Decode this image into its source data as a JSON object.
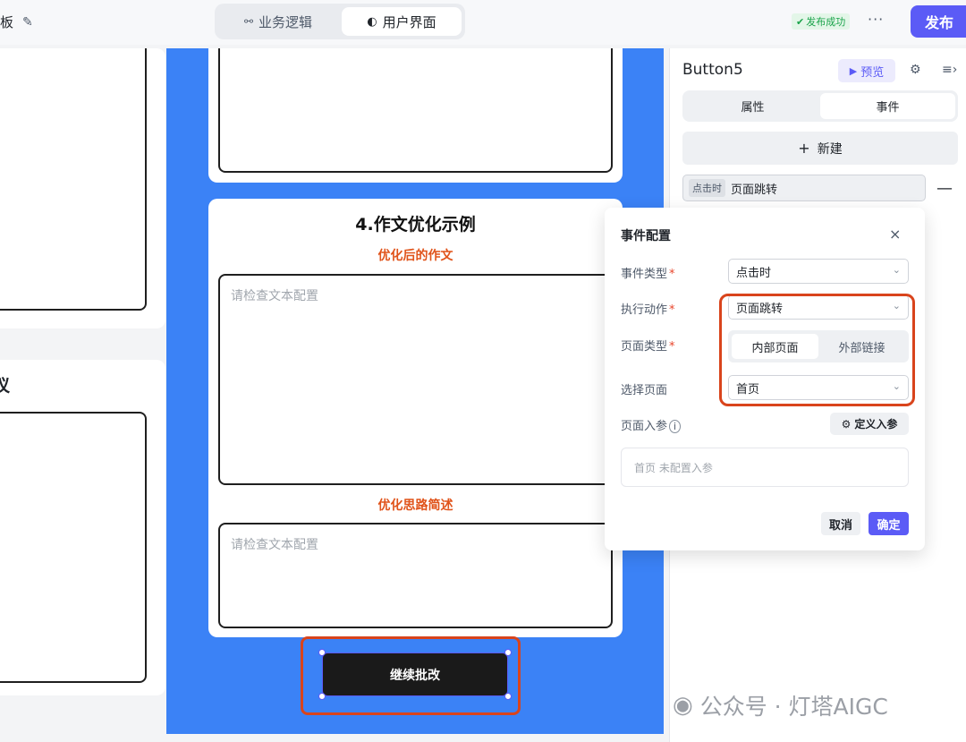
{
  "topbar": {
    "left_text": "板",
    "tabs": [
      {
        "icon": "flow-icon",
        "label": "业务逻辑"
      },
      {
        "icon": "palette-icon",
        "label": "用户界面"
      }
    ],
    "status_badge": "发布成功",
    "more": "···",
    "publish_label": "发布"
  },
  "canvas": {
    "left_fragment": "议",
    "card4": {
      "title": "4.作文优化示例",
      "subtitle_1": "优化后的作文",
      "placeholder_1": "请检查文本配置",
      "subtitle_2": "优化思路简述",
      "placeholder_2": "请检查文本配置"
    },
    "main_button_label": "继续批改"
  },
  "panel": {
    "title": "Button5",
    "preview_label": "预览",
    "tabs": [
      "属性",
      "事件"
    ],
    "active_tab": "事件",
    "new_label": "新建",
    "event_row": {
      "tag": "点击时",
      "label": "页面跳转"
    },
    "remove_icon": "—"
  },
  "popover": {
    "title": "事件配置",
    "close": "×",
    "event_type_label": "事件类型",
    "event_type_value": "点击时",
    "action_label": "执行动作",
    "action_value": "页面跳转",
    "page_type_label": "页面类型",
    "page_type_options": [
      "内部页面",
      "外部链接"
    ],
    "page_type_selected": "内部页面",
    "select_page_label": "选择页面",
    "select_page_value": "首页",
    "params_label": "页面入参",
    "define_params_label": "定义入参",
    "params_empty": "首页 未配置入参",
    "cancel_label": "取消",
    "ok_label": "确定"
  },
  "watermark": "公众号 · 灯塔AIGC",
  "colors": {
    "accent": "#5b5bf6",
    "canvas_blue": "#3b82f6",
    "highlight_red": "#d9441c",
    "subtitle_orange": "#e0531a"
  }
}
